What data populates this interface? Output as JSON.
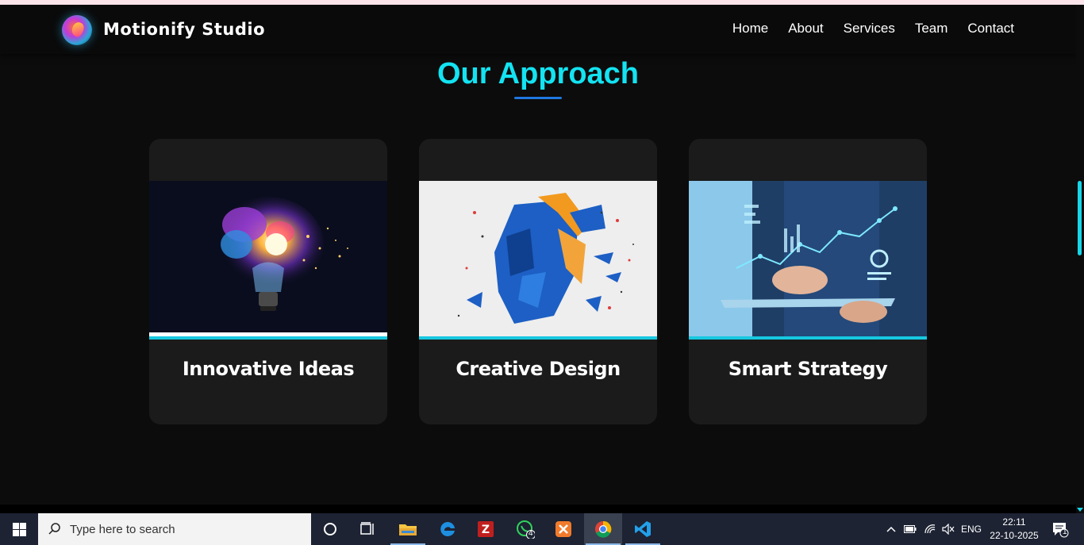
{
  "header": {
    "brand": "Motionify Studio",
    "nav": [
      "Home",
      "About",
      "Services",
      "Team",
      "Contact"
    ]
  },
  "section": {
    "title": "Our Approach"
  },
  "cards": [
    {
      "title": "Innovative Ideas",
      "image": "exploding-lightbulb"
    },
    {
      "title": "Creative Design",
      "image": "low-poly-face"
    },
    {
      "title": "Smart Strategy",
      "image": "tablet-analytics"
    }
  ],
  "taskbar": {
    "search_placeholder": "Type here to search",
    "whatsapp_badge": "4",
    "language": "ENG",
    "time": "22:11",
    "date": "22-10-2025",
    "notification_count": "1"
  },
  "colors": {
    "accent": "#13e3f2",
    "underline": "#1f77e0",
    "card_bg": "#1b1b1b",
    "page_bg": "#0c0c0c"
  }
}
